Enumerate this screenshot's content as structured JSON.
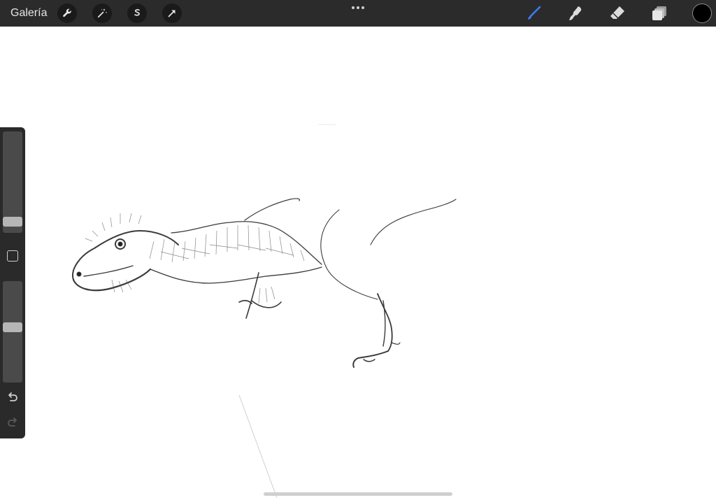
{
  "toolbar": {
    "gallery_label": "Galería",
    "left_tools": [
      "wrench-icon",
      "magic-wand-icon",
      "selection-s-icon",
      "transform-arrow-icon"
    ],
    "right_tools": [
      "brush-icon",
      "smudge-icon",
      "eraser-icon",
      "layers-icon"
    ],
    "active_tool": "brush-icon",
    "active_tool_color": "#3d7bfd",
    "current_color": "#000000"
  },
  "sidebar": {
    "brush_size_level": 0.07,
    "opacity_level": 0.55
  },
  "colors": {
    "toolbar_bg": "#2b2b2b",
    "canvas_bg": "#ffffff",
    "sidebar_bg": "#2a2a2a"
  }
}
